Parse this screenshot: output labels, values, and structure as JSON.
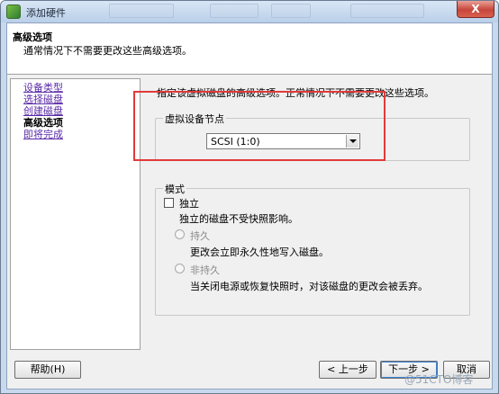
{
  "window": {
    "title": "添加硬件",
    "close_glyph": "X",
    "colors": {
      "titlebar": "#c8d9ee",
      "link": "#5a2ba8",
      "highlight": "#e23a3a"
    }
  },
  "header": {
    "title": "高级选项",
    "subtitle": "通常情况下不需要更改这些高级选项。"
  },
  "nav": {
    "items": [
      {
        "label": "设备类型",
        "state": "link"
      },
      {
        "label": "选择磁盘",
        "state": "link"
      },
      {
        "label": "创建磁盘",
        "state": "link"
      },
      {
        "label": "高级选项",
        "state": "current"
      },
      {
        "label": "即将完成",
        "state": "link"
      }
    ]
  },
  "main": {
    "description": "指定该虚拟磁盘的高级选项。正常情况下不需要更改这些选项。",
    "vdn_group": {
      "legend": "虚拟设备节点",
      "selected": "SCSI (1:0)"
    },
    "mode_group": {
      "legend": "模式",
      "independent_label": "独立",
      "independent_checked": false,
      "independent_desc": "独立的磁盘不受快照影响。",
      "persistent_label": "持久",
      "persistent_desc": "更改会立即永久性地写入磁盘。",
      "nonpersistent_label": "非持久",
      "nonpersistent_desc": "当关闭电源或恢复快照时，对该磁盘的更改会被丢弃。"
    }
  },
  "footer": {
    "help": "帮助(H)",
    "back": "< 上一步",
    "next": "下一步 >",
    "cancel": "取消"
  },
  "watermark": "@51CTO博客"
}
